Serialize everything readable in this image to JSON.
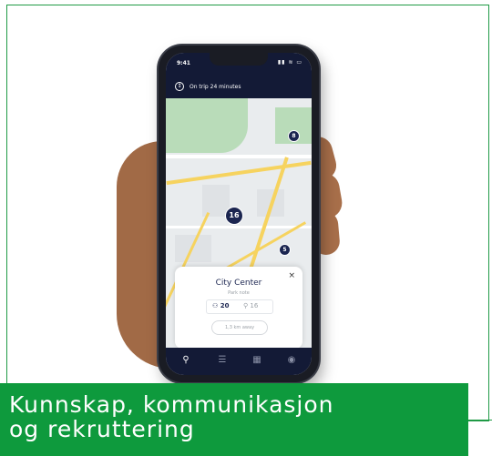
{
  "phone": {
    "status_time": "9:41",
    "status_icons": "▮▮ ≋ ▭",
    "trip_icon": "↕",
    "trip_text": "On trip 24 minutes",
    "markers": [
      "8",
      "16",
      "5"
    ],
    "card": {
      "close": "×",
      "title": "City Center",
      "subtitle": "Park note",
      "count_available": "20",
      "count_secondary": "16",
      "button_label": "1,3 km away"
    },
    "tabs": [
      "⚲",
      "☰",
      "▦",
      "◉"
    ]
  },
  "banner": {
    "line1": "Kunnskap, kommunikasjon",
    "line2": "og rekruttering"
  }
}
